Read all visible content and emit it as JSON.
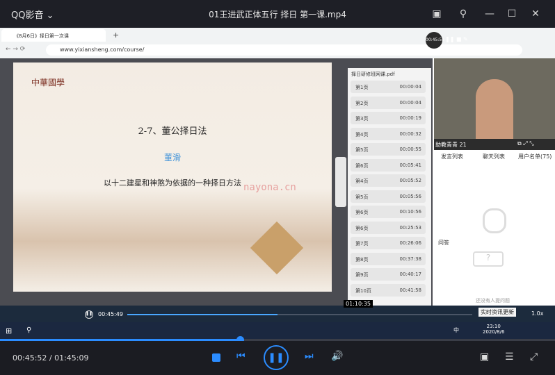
{
  "player": {
    "app_name": "QQ影音 ⌄",
    "file_title": "01王进武正体五行 择日 第一课.mp4",
    "current_time": "00:45:52 / 01:45:09",
    "hover_time": "01:10:35"
  },
  "browser": {
    "tab_title": "《8月6日》择日第一次课",
    "url": "www.yixiansheng.com/course/"
  },
  "slide": {
    "logo": "中華國學",
    "title": "2-7、董公择日法",
    "subtitle": "董滑",
    "body": "以十二建星和神煞为依据的一种择日方法",
    "watermark": "nayona.cn"
  },
  "panel": {
    "pdf_name": "择日研修班网课.pdf",
    "pages": [
      {
        "n": "第1页",
        "t": "00:00:04"
      },
      {
        "n": "第2页",
        "t": "00:00:04"
      },
      {
        "n": "第3页",
        "t": "00:00:19"
      },
      {
        "n": "第4页",
        "t": "00:00:32"
      },
      {
        "n": "第5页",
        "t": "00:00:55"
      },
      {
        "n": "第6页",
        "t": "00:05:41"
      },
      {
        "n": "第4页",
        "t": "00:05:52"
      },
      {
        "n": "第5页",
        "t": "00:05:56"
      },
      {
        "n": "第6页",
        "t": "00:10:56"
      },
      {
        "n": "第6页",
        "t": "00:25:53"
      },
      {
        "n": "第7页",
        "t": "00:26:06"
      },
      {
        "n": "第8页",
        "t": "00:37:38"
      },
      {
        "n": "第9页",
        "t": "00:40:17"
      },
      {
        "n": "第10页",
        "t": "00:41:58"
      }
    ]
  },
  "live": {
    "timer": "00:45:51",
    "host": "助教青青 21",
    "tabs": [
      "发言列表",
      "聊天列表",
      "用户名单(75)"
    ],
    "qa": "问答",
    "no_q": "还没有人提问题"
  },
  "web_player": {
    "time": "00:45:49",
    "speed": "1.0x",
    "news": "实时资讯更新"
  },
  "taskbar": {
    "time": "23:10",
    "date": "2020/8/6",
    "ime": "中"
  }
}
